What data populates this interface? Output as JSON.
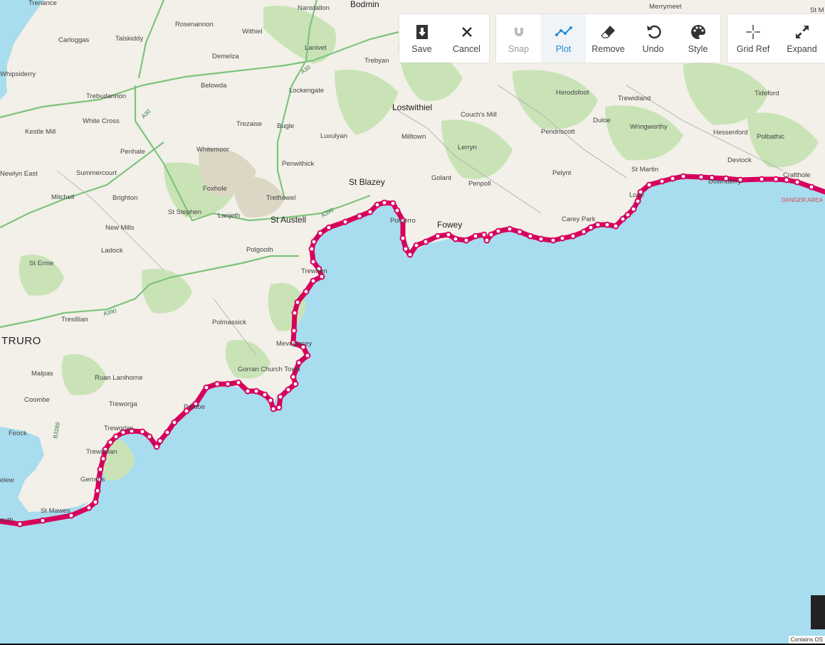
{
  "toolbar": {
    "save": "Save",
    "cancel": "Cancel",
    "snap": "Snap",
    "plot": "Plot",
    "remove": "Remove",
    "undo": "Undo",
    "style": "Style",
    "grid_ref": "Grid Ref",
    "expand": "Expand"
  },
  "colors": {
    "route": "#d6005c",
    "sea": "#a8dcef",
    "land": "#f2f0e8",
    "woods": "#c7e2b4",
    "accent": "#1f8fd6"
  },
  "places": {
    "trenance": "Trenance",
    "nanstallon": "Nanstallon",
    "bodmin": "Bodmin",
    "merrymeet": "Merrymeet",
    "stm": "St M",
    "carloggas": "Carloggas",
    "talskiddy": "Talskiddy",
    "rosenannon": "Rosenannon",
    "withiel": "Withiel",
    "lanivet": "Lanivet",
    "demelza": "Demelza",
    "trebyan": "Trebyan",
    "whipsiderry": "Whipsiderry",
    "belowda": "Belowda",
    "lockengate": "Lockengate",
    "trebudannon": "Trebudannon",
    "herodsfoot": "Herodsfoot",
    "trewidland": "Trewidland",
    "tideford": "Tideford",
    "lostwithiel": "Lostwithiel",
    "couchs_mill": "Couch's Mill",
    "kestle_mill": "Kestle Mill",
    "white_cross": "White Cross",
    "trezaise": "Trezaise",
    "bugle": "Bugle",
    "luxulyan": "Luxulyan",
    "milltown": "Milltown",
    "pendriscott": "Pendriscott",
    "duloe": "Duloe",
    "wringworthy": "Wringworthy",
    "hessenford": "Hessenford",
    "polbathic": "Polbathic",
    "penhale": "Penhale",
    "whitemoor": "Whitemoor",
    "lerryn": "Lerryn",
    "deviock": "Deviock",
    "newlyn_east": "Newlyn East",
    "summercourt": "Summercourt",
    "penwithick": "Penwithick",
    "st_martin": "St Martin",
    "crafthole": "Crafthole",
    "pelynt": "Pelynt",
    "golant": "Golant",
    "st_blazey": "St Blazey",
    "penpoll": "Penpoll",
    "downderry": "Downderry",
    "danger_area": "DANGER AREA",
    "mitchell": "Mitchell",
    "brighton": "Brighton",
    "foxhole": "Foxhole",
    "trethowel": "Trethowel",
    "looe": "Looe",
    "st_stephen": "St Stephen",
    "lanjeth": "Lanjeth",
    "st_austell": "St Austell",
    "polperro": "Polperro",
    "carey_park": "Carey Park",
    "new_mills": "New Mills",
    "fowey": "Fowey",
    "ladock": "Ladock",
    "polgooth": "Polgooth",
    "st_erme": "St Erme",
    "trewhen": "Trewhen",
    "tresillian": "Tresillian",
    "polmassick": "Polmassick",
    "truro": "TRURO",
    "mevagissey": "Mevagissey",
    "gorran_church_town": "Gorran Church Town",
    "malpas": "Malpas",
    "ruan_lanihorne": "Ruan Lanihorne",
    "coombe": "Coombe",
    "treworga": "Treworga",
    "portloe": "Portloe",
    "feock": "Feock",
    "treworlas": "Treworlas",
    "trewithian": "Trewithian",
    "gerrans": "Gerrans",
    "elew": "elew",
    "st_mawes": "St Mawes",
    "falmouth": "outh"
  },
  "roads": {
    "a30": "A30",
    "a390": "A390",
    "a3082": "A390",
    "b3289": "B3289"
  },
  "attribution": "Contains OS"
}
